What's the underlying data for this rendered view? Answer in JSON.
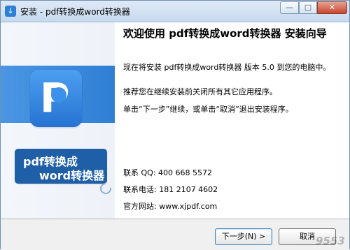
{
  "window": {
    "title": "安装 - pdf转换成word转换器",
    "controls": {
      "minimize": "—",
      "maximize": "□",
      "close": "✕"
    }
  },
  "brand": {
    "line1": "pdf转换成",
    "line2": "word转换器",
    "logo_icon": "p-logo-icon",
    "accent": "#2f7fd5"
  },
  "content": {
    "heading": "欢迎使用 pdf转换成word转换器 安装向导",
    "paragraph1": "现在将安装 pdf转换成word转换器 版本 5.0 到您的电脑中。",
    "paragraph2": "推荐您在继续安装前关闭所有其它应用程序。",
    "paragraph3": "单击“下一步”继续，或单击“取消”退出安装程序。",
    "contacts": [
      "联系 QQ: 400 668 5572",
      "联系电话: 181 2107 4602",
      "官方网站: www.xjpdf.com"
    ]
  },
  "buttons": {
    "next": "下一步(N) >",
    "cancel": "取消"
  },
  "watermark": "9553"
}
